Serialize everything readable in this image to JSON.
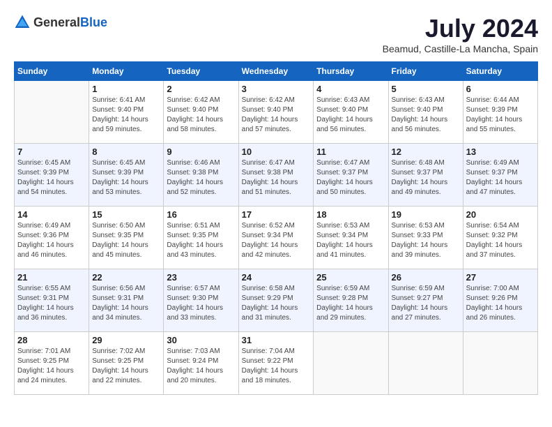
{
  "header": {
    "logo_general": "General",
    "logo_blue": "Blue",
    "month_year": "July 2024",
    "location": "Beamud, Castille-La Mancha, Spain"
  },
  "days_of_week": [
    "Sunday",
    "Monday",
    "Tuesday",
    "Wednesday",
    "Thursday",
    "Friday",
    "Saturday"
  ],
  "weeks": [
    [
      {
        "day": "",
        "info": ""
      },
      {
        "day": "1",
        "info": "Sunrise: 6:41 AM\nSunset: 9:40 PM\nDaylight: 14 hours\nand 59 minutes."
      },
      {
        "day": "2",
        "info": "Sunrise: 6:42 AM\nSunset: 9:40 PM\nDaylight: 14 hours\nand 58 minutes."
      },
      {
        "day": "3",
        "info": "Sunrise: 6:42 AM\nSunset: 9:40 PM\nDaylight: 14 hours\nand 57 minutes."
      },
      {
        "day": "4",
        "info": "Sunrise: 6:43 AM\nSunset: 9:40 PM\nDaylight: 14 hours\nand 56 minutes."
      },
      {
        "day": "5",
        "info": "Sunrise: 6:43 AM\nSunset: 9:40 PM\nDaylight: 14 hours\nand 56 minutes."
      },
      {
        "day": "6",
        "info": "Sunrise: 6:44 AM\nSunset: 9:39 PM\nDaylight: 14 hours\nand 55 minutes."
      }
    ],
    [
      {
        "day": "7",
        "info": "Sunrise: 6:45 AM\nSunset: 9:39 PM\nDaylight: 14 hours\nand 54 minutes."
      },
      {
        "day": "8",
        "info": "Sunrise: 6:45 AM\nSunset: 9:39 PM\nDaylight: 14 hours\nand 53 minutes."
      },
      {
        "day": "9",
        "info": "Sunrise: 6:46 AM\nSunset: 9:38 PM\nDaylight: 14 hours\nand 52 minutes."
      },
      {
        "day": "10",
        "info": "Sunrise: 6:47 AM\nSunset: 9:38 PM\nDaylight: 14 hours\nand 51 minutes."
      },
      {
        "day": "11",
        "info": "Sunrise: 6:47 AM\nSunset: 9:37 PM\nDaylight: 14 hours\nand 50 minutes."
      },
      {
        "day": "12",
        "info": "Sunrise: 6:48 AM\nSunset: 9:37 PM\nDaylight: 14 hours\nand 49 minutes."
      },
      {
        "day": "13",
        "info": "Sunrise: 6:49 AM\nSunset: 9:37 PM\nDaylight: 14 hours\nand 47 minutes."
      }
    ],
    [
      {
        "day": "14",
        "info": "Sunrise: 6:49 AM\nSunset: 9:36 PM\nDaylight: 14 hours\nand 46 minutes."
      },
      {
        "day": "15",
        "info": "Sunrise: 6:50 AM\nSunset: 9:35 PM\nDaylight: 14 hours\nand 45 minutes."
      },
      {
        "day": "16",
        "info": "Sunrise: 6:51 AM\nSunset: 9:35 PM\nDaylight: 14 hours\nand 43 minutes."
      },
      {
        "day": "17",
        "info": "Sunrise: 6:52 AM\nSunset: 9:34 PM\nDaylight: 14 hours\nand 42 minutes."
      },
      {
        "day": "18",
        "info": "Sunrise: 6:53 AM\nSunset: 9:34 PM\nDaylight: 14 hours\nand 41 minutes."
      },
      {
        "day": "19",
        "info": "Sunrise: 6:53 AM\nSunset: 9:33 PM\nDaylight: 14 hours\nand 39 minutes."
      },
      {
        "day": "20",
        "info": "Sunrise: 6:54 AM\nSunset: 9:32 PM\nDaylight: 14 hours\nand 37 minutes."
      }
    ],
    [
      {
        "day": "21",
        "info": "Sunrise: 6:55 AM\nSunset: 9:31 PM\nDaylight: 14 hours\nand 36 minutes."
      },
      {
        "day": "22",
        "info": "Sunrise: 6:56 AM\nSunset: 9:31 PM\nDaylight: 14 hours\nand 34 minutes."
      },
      {
        "day": "23",
        "info": "Sunrise: 6:57 AM\nSunset: 9:30 PM\nDaylight: 14 hours\nand 33 minutes."
      },
      {
        "day": "24",
        "info": "Sunrise: 6:58 AM\nSunset: 9:29 PM\nDaylight: 14 hours\nand 31 minutes."
      },
      {
        "day": "25",
        "info": "Sunrise: 6:59 AM\nSunset: 9:28 PM\nDaylight: 14 hours\nand 29 minutes."
      },
      {
        "day": "26",
        "info": "Sunrise: 6:59 AM\nSunset: 9:27 PM\nDaylight: 14 hours\nand 27 minutes."
      },
      {
        "day": "27",
        "info": "Sunrise: 7:00 AM\nSunset: 9:26 PM\nDaylight: 14 hours\nand 26 minutes."
      }
    ],
    [
      {
        "day": "28",
        "info": "Sunrise: 7:01 AM\nSunset: 9:25 PM\nDaylight: 14 hours\nand 24 minutes."
      },
      {
        "day": "29",
        "info": "Sunrise: 7:02 AM\nSunset: 9:25 PM\nDaylight: 14 hours\nand 22 minutes."
      },
      {
        "day": "30",
        "info": "Sunrise: 7:03 AM\nSunset: 9:24 PM\nDaylight: 14 hours\nand 20 minutes."
      },
      {
        "day": "31",
        "info": "Sunrise: 7:04 AM\nSunset: 9:22 PM\nDaylight: 14 hours\nand 18 minutes."
      },
      {
        "day": "",
        "info": ""
      },
      {
        "day": "",
        "info": ""
      },
      {
        "day": "",
        "info": ""
      }
    ]
  ]
}
